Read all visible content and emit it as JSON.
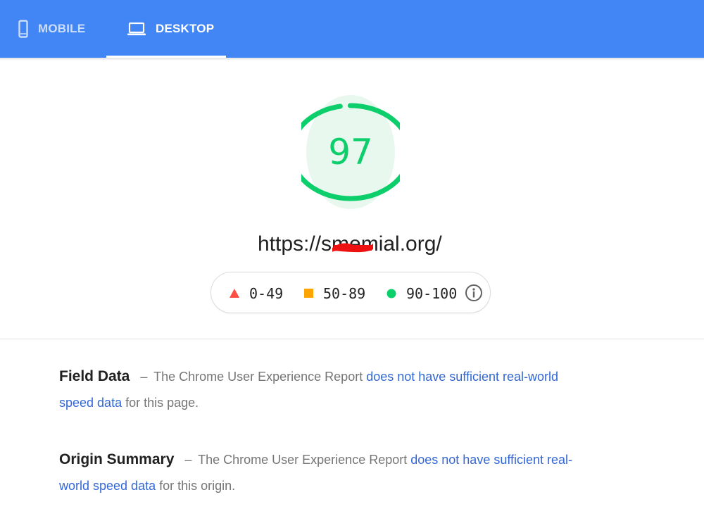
{
  "tabs": [
    {
      "label": "MOBILE",
      "icon": "smartphone-icon",
      "active": false
    },
    {
      "label": "DESKTOP",
      "icon": "laptop-icon",
      "active": true
    }
  ],
  "score": {
    "value": "97",
    "fraction": 0.97,
    "color": "#0cce6b",
    "url": "https://smemial.org/"
  },
  "legend": {
    "items": [
      {
        "range": "0-49",
        "icon": "triangle-icon",
        "color": "#ff4e42"
      },
      {
        "range": "50-89",
        "icon": "square-icon",
        "color": "#ffa400"
      },
      {
        "range": "90-100",
        "icon": "circle-icon",
        "color": "#0cce6b"
      }
    ],
    "info_icon": "info-icon"
  },
  "sections": [
    {
      "heading": "Field Data",
      "dash": "–",
      "text_before": "The Chrome User Experience Report ",
      "link": "does not have sufficient real-world speed data",
      "text_after": " for this page."
    },
    {
      "heading": "Origin Summary",
      "dash": "–",
      "text_before": "The Chrome User Experience Report ",
      "link": "does not have sufficient real-world speed data",
      "text_after": " for this origin."
    }
  ],
  "colors": {
    "header": "#4285f4",
    "link": "#3367d6",
    "pass": "#0cce6b",
    "average": "#ffa400",
    "fail": "#ff4e42"
  }
}
